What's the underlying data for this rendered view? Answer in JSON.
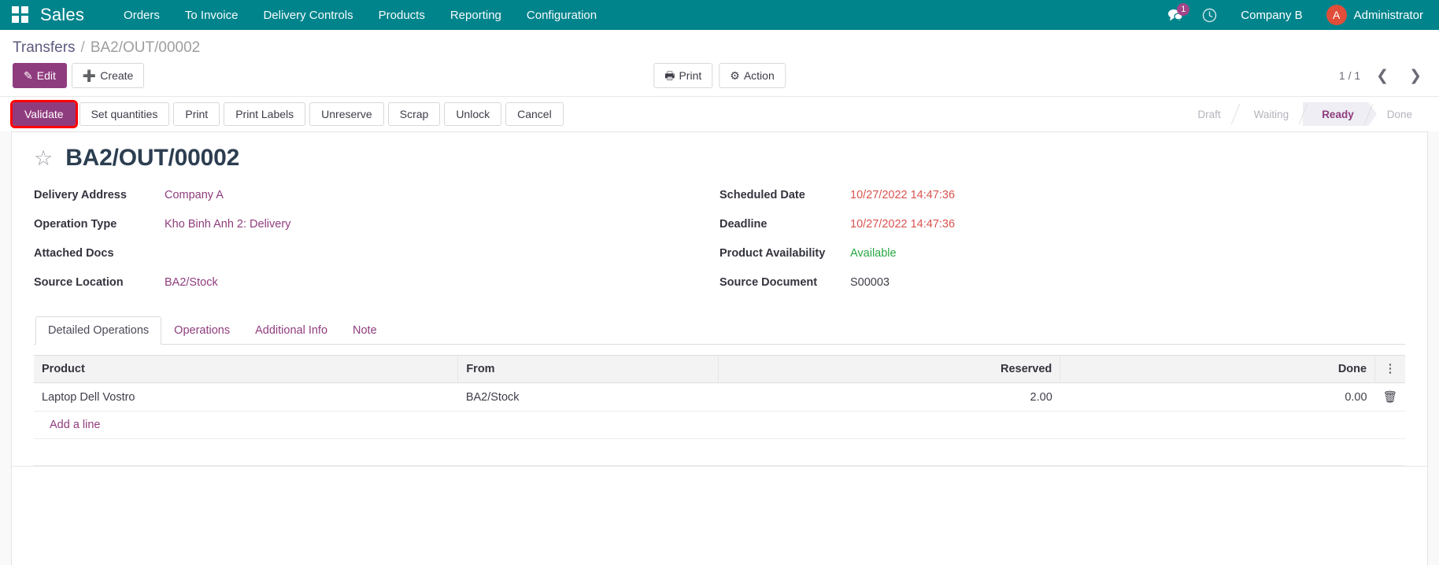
{
  "navbar": {
    "apps_icon": "apps-grid-icon",
    "brand": "Sales",
    "menu": [
      {
        "label": "Orders"
      },
      {
        "label": "To Invoice"
      },
      {
        "label": "Delivery Controls"
      },
      {
        "label": "Products"
      },
      {
        "label": "Reporting"
      },
      {
        "label": "Configuration"
      }
    ],
    "messages_icon": "chat-bubble-icon",
    "messages_count": "1",
    "activity_icon": "clock-icon",
    "company": "Company B",
    "avatar_initial": "A",
    "user": "Administrator",
    "bg_color": "#00848c"
  },
  "breadcrumb": {
    "root": "Transfers",
    "separator": "/",
    "current": "BA2/OUT/00002"
  },
  "control_panel": {
    "edit_label": "Edit",
    "edit_icon": "pencil-icon",
    "create_label": "Create",
    "create_icon": "plus-icon",
    "print_label": "Print",
    "print_icon": "printer-icon",
    "action_label": "Action",
    "action_icon": "gear-icon",
    "pager_value": "1 / 1",
    "prev_icon": "chevron-left-icon",
    "next_icon": "chevron-right-icon"
  },
  "statusbar": {
    "buttons": [
      {
        "label": "Validate",
        "primary": true,
        "highlighted": true
      },
      {
        "label": "Set quantities",
        "primary": false,
        "highlighted": false
      },
      {
        "label": "Print",
        "primary": false,
        "highlighted": false
      },
      {
        "label": "Print Labels",
        "primary": false,
        "highlighted": false
      },
      {
        "label": "Unreserve",
        "primary": false,
        "highlighted": false
      },
      {
        "label": "Scrap",
        "primary": false,
        "highlighted": false
      },
      {
        "label": "Unlock",
        "primary": false,
        "highlighted": false
      },
      {
        "label": "Cancel",
        "primary": false,
        "highlighted": false
      }
    ],
    "states": [
      {
        "label": "Draft",
        "active": false
      },
      {
        "label": "Waiting",
        "active": false
      },
      {
        "label": "Ready",
        "active": true
      },
      {
        "label": "Done",
        "active": false
      }
    ],
    "active_color": "#8f3c7e"
  },
  "record": {
    "favorite_icon": "star-outline-icon",
    "title": "BA2/OUT/00002",
    "left_fields": [
      {
        "label": "Delivery Address",
        "value": "Company A",
        "style": "link"
      },
      {
        "label": "Operation Type",
        "value": "Kho Binh Anh 2: Delivery",
        "style": "link"
      },
      {
        "label": "Attached Docs",
        "value": "",
        "style": "plain"
      },
      {
        "label": "Source Location",
        "value": "BA2/Stock",
        "style": "link"
      }
    ],
    "right_fields": [
      {
        "label": "Scheduled Date",
        "value": "10/27/2022 14:47:36",
        "style": "date"
      },
      {
        "label": "Deadline",
        "value": "10/27/2022 14:47:36",
        "style": "date"
      },
      {
        "label": "Product Availability",
        "value": "Available",
        "style": "ok"
      },
      {
        "label": "Source Document",
        "value": "S00003",
        "style": "plain"
      }
    ]
  },
  "notebook": {
    "tabs": [
      {
        "label": "Detailed Operations",
        "active": true
      },
      {
        "label": "Operations",
        "active": false
      },
      {
        "label": "Additional Info",
        "active": false
      },
      {
        "label": "Note",
        "active": false
      }
    ]
  },
  "lines_table": {
    "columns": [
      {
        "label": "Product",
        "align": "left"
      },
      {
        "label": "From",
        "align": "left"
      },
      {
        "label": "Reserved",
        "align": "right"
      },
      {
        "label": "Done",
        "align": "right"
      }
    ],
    "options_icon": "column-options-icon",
    "rows": [
      {
        "product": "Laptop Dell Vostro",
        "from": "BA2/Stock",
        "reserved": "2.00",
        "done": "0.00",
        "delete_icon": "trash-icon"
      }
    ],
    "add_line_label": "Add a line"
  }
}
